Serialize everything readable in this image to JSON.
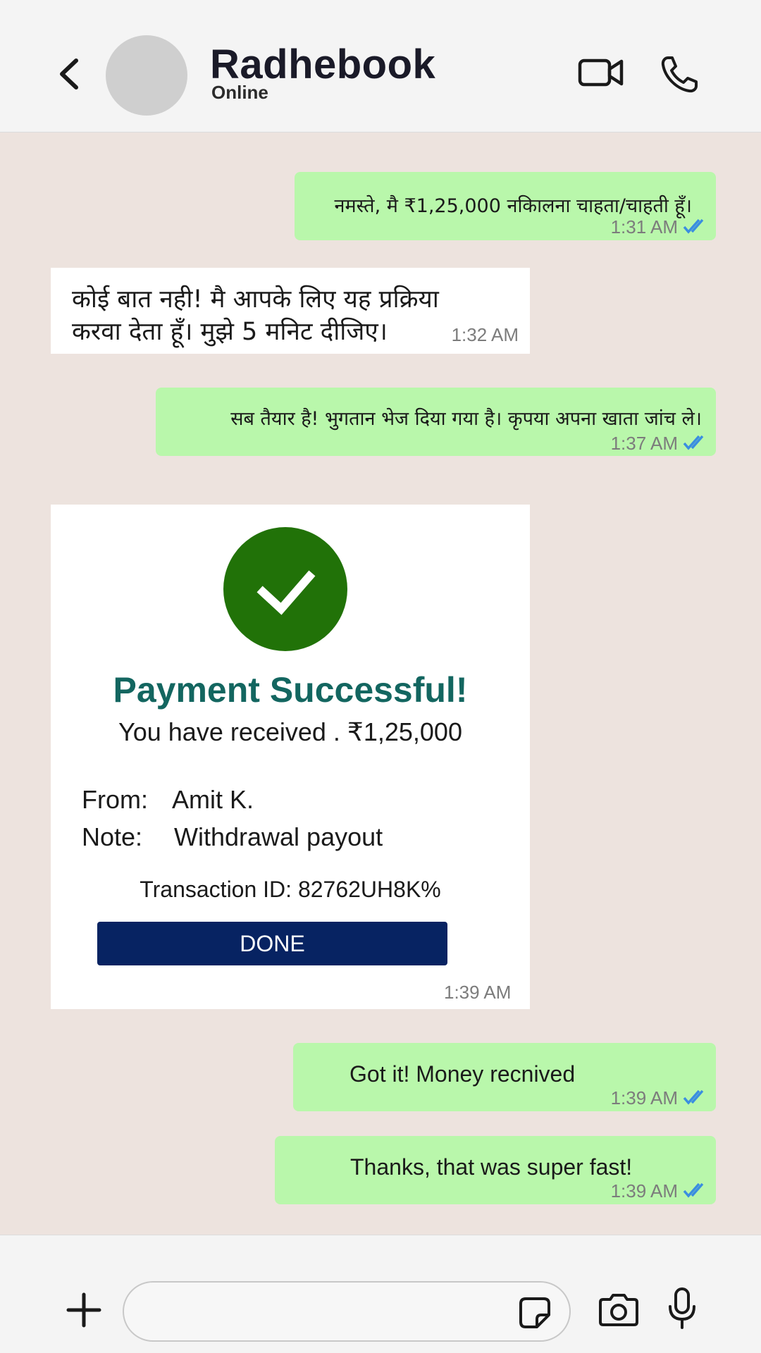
{
  "header": {
    "contact_name": "Radhebook",
    "status": "Online",
    "icons": [
      "chevron-left-icon",
      "avatar",
      "video-camera-icon",
      "phone-icon"
    ]
  },
  "messages": [
    {
      "direction": "outgoing",
      "text": "नमस्ते, मै ₹1,25,000 नकािलना चाहता/चाहती हूँ।",
      "time": "1:31 AM",
      "read": true
    },
    {
      "direction": "incoming",
      "lines": [
        "कोई बात नही! मै आपके लिए यह प्रक्रिया",
        "करवा देता हूँ। मुझे 5 मनिट दीजिए।"
      ],
      "time": "1:32 AM"
    },
    {
      "direction": "outgoing",
      "text": "सब तैयार है! भुगतान भेज दिया गया है। कृपया अपना खाता जांच ले।",
      "time": "1:37 AM",
      "read": true
    },
    {
      "direction": "incoming",
      "type": "payment-card",
      "title": "Payment Successful!",
      "subtitle": "You have received . ₹1,25,000",
      "from_label": "From:",
      "from_value": "Amit K.",
      "note_label": "Note:",
      "note_value": "Withdrawal payout",
      "transaction": "Transaction ID: 82762UH8K%",
      "button": "DONE",
      "time": "1:39 AM"
    },
    {
      "direction": "outgoing",
      "text": "Got it! Money recnived",
      "time": "1:39 AM",
      "read": true
    },
    {
      "direction": "outgoing",
      "text": "Thanks, that was super fast!",
      "time": "1:39 AM",
      "read": true
    }
  ],
  "footer": {
    "input_value": "",
    "icons": [
      "plus-icon",
      "sticker-icon",
      "camera-icon",
      "microphone-icon"
    ]
  },
  "colors": {
    "chat_background": "#ede3de",
    "outgoing_bubble": "#b9f7ab",
    "incoming_bubble": "#ffffff",
    "success_green": "#217208",
    "title_teal": "#136660",
    "button_navy": "#072362",
    "read_ticks": "#3a8ee0"
  }
}
